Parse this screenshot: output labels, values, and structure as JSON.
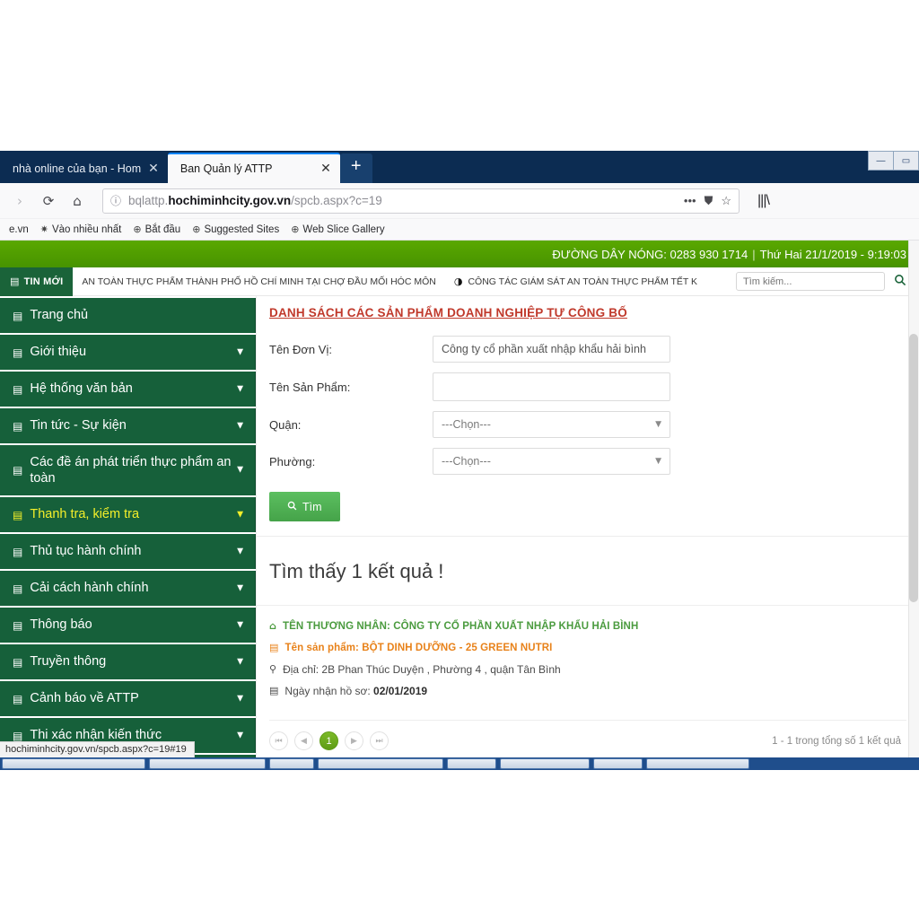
{
  "browser": {
    "tabs": [
      {
        "title": "nhà online của bạn - Hom",
        "active": false,
        "close": "✕"
      },
      {
        "title": "Ban Quản lý ATTP",
        "active": true,
        "close": "✕"
      }
    ],
    "new_tab_label": "+",
    "window_controls": [
      "▭",
      "▭"
    ],
    "nav": {
      "forward_icon": "›",
      "reload_icon": "⟳",
      "home_icon": "⌂",
      "info_icon": "ⓘ",
      "url_prefix": "bqlattp.",
      "url_host": "hochiminhcity.gov.vn",
      "url_path": "/spcb.aspx?c=19",
      "menu_icon": "•••",
      "shield_icon": "⛊",
      "star_icon": "☆",
      "library_icon": "|||\\"
    },
    "bookmarks": [
      {
        "label": "e.vn",
        "icon": ""
      },
      {
        "label": "Vào nhiều nhất",
        "icon": "✷"
      },
      {
        "label": "Bắt đầu",
        "icon": "⊕"
      },
      {
        "label": "Suggested Sites",
        "icon": "⊕"
      },
      {
        "label": "Web Slice Gallery",
        "icon": "⊕"
      }
    ],
    "status_link": "hochiminhcity.gov.vn/spcb.aspx?c=19#19"
  },
  "site": {
    "hotline_label": "ĐƯỜNG DÂY NÓNG:",
    "hotline_number": "0283 930 1714",
    "separator": "|",
    "datetime": "Thứ Hai 21/1/2019 - 9:19:03",
    "ticker": {
      "badge": "TIN MỚI",
      "badge_icon": "▤",
      "items": [
        {
          "icon": "",
          "text": "AN TOÀN THỰC PHẨM THÀNH PHỐ HỒ CHÍ MINH TẠI CHỢ ĐẦU MỐI HÓC MÔN"
        },
        {
          "icon": "◑",
          "text": "CÔNG TÁC GIÁM SÁT AN TOÀN THỰC PHẨM TẾT K"
        }
      ],
      "search_placeholder": "Tìm kiếm...",
      "search_value": "",
      "search_icon": "🔍"
    }
  },
  "sidebar": {
    "items": [
      {
        "label": "Trang chủ",
        "icon": "▤",
        "caret": "",
        "highlight": false,
        "tall": false
      },
      {
        "label": "Giới thiệu",
        "icon": "▤",
        "caret": "▼",
        "highlight": false,
        "tall": false
      },
      {
        "label": "Hệ thống văn bản",
        "icon": "▤",
        "caret": "▼",
        "highlight": false,
        "tall": false
      },
      {
        "label": "Tin tức - Sự kiện",
        "icon": "▤",
        "caret": "▼",
        "highlight": false,
        "tall": false
      },
      {
        "label": "Các đề án phát triển thực phẩm an toàn",
        "icon": "▤",
        "caret": "▼",
        "highlight": false,
        "tall": true
      },
      {
        "label": "Thanh tra, kiểm tra",
        "icon": "▤",
        "caret": "▼",
        "highlight": true,
        "tall": false
      },
      {
        "label": "Thủ tục hành chính",
        "icon": "▤",
        "caret": "▼",
        "highlight": false,
        "tall": false
      },
      {
        "label": "Cải cách hành chính",
        "icon": "▤",
        "caret": "▼",
        "highlight": false,
        "tall": false
      },
      {
        "label": "Thông báo",
        "icon": "▤",
        "caret": "▼",
        "highlight": false,
        "tall": false
      },
      {
        "label": "Truyền thông",
        "icon": "▤",
        "caret": "▼",
        "highlight": false,
        "tall": false
      },
      {
        "label": "Cảnh báo về ATTP",
        "icon": "▤",
        "caret": "▼",
        "highlight": false,
        "tall": false
      },
      {
        "label": "Thi xác nhận kiến thức",
        "icon": "▤",
        "caret": "▼",
        "highlight": false,
        "tall": false
      },
      {
        "label": "",
        "icon": "",
        "caret": "▼",
        "highlight": false,
        "tall": false
      }
    ]
  },
  "main": {
    "page_title": "DANH SÁCH CÁC SẢN PHẨM DOANH NGHIỆP TỰ CÔNG BỐ",
    "form": {
      "unit_label": "Tên Đơn Vị:",
      "unit_value": "Công ty cổ phần xuất nhập khẩu hải bình",
      "product_label": "Tên Sản Phẩm:",
      "product_value": "",
      "district_label": "Quận:",
      "district_value": "---Chọn---",
      "ward_label": "Phường:",
      "ward_value": "---Chọn---",
      "submit_label": "Tìm",
      "submit_icon": "🔍",
      "select_caret": "▼"
    },
    "results": {
      "heading": "Tìm thấy 1 kết quả !",
      "items": [
        {
          "merchant_icon": "⌂",
          "merchant_label": "TÊN THƯƠNG NHÂN:",
          "merchant_value": "CÔNG TY CỔ PHẦN XUẤT NHẬP KHẨU HẢI BÌNH",
          "product_icon": "▤",
          "product_label": "Tên sản phẩm:",
          "product_value": "BỘT DINH DƯỠNG - 25 GREEN NUTRI",
          "address_icon": "⚲",
          "address_label": "Địa chỉ:",
          "address_value": "2B Phan Thúc Duyện , Phường 4 , quận Tân Bình",
          "date_icon": "▤",
          "date_label": "Ngày nhận hồ sơ:",
          "date_value": "02/01/2019"
        }
      ],
      "pagination": {
        "first": "⏮",
        "prev": "◀",
        "current": "1",
        "next": "▶",
        "last": "⏭",
        "info": "1 - 1 trong tổng số 1 kết quả"
      }
    }
  },
  "colors": {
    "hotline_green": "#4c9a00",
    "sidebar_green": "#16603a",
    "button_green": "#4caf50",
    "title_red": "#c0392b",
    "merchant_green": "#4b9b3f",
    "product_orange": "#e8821a",
    "highlight_yellow": "#f3ef2a",
    "pager_green": "#6aa81e"
  }
}
